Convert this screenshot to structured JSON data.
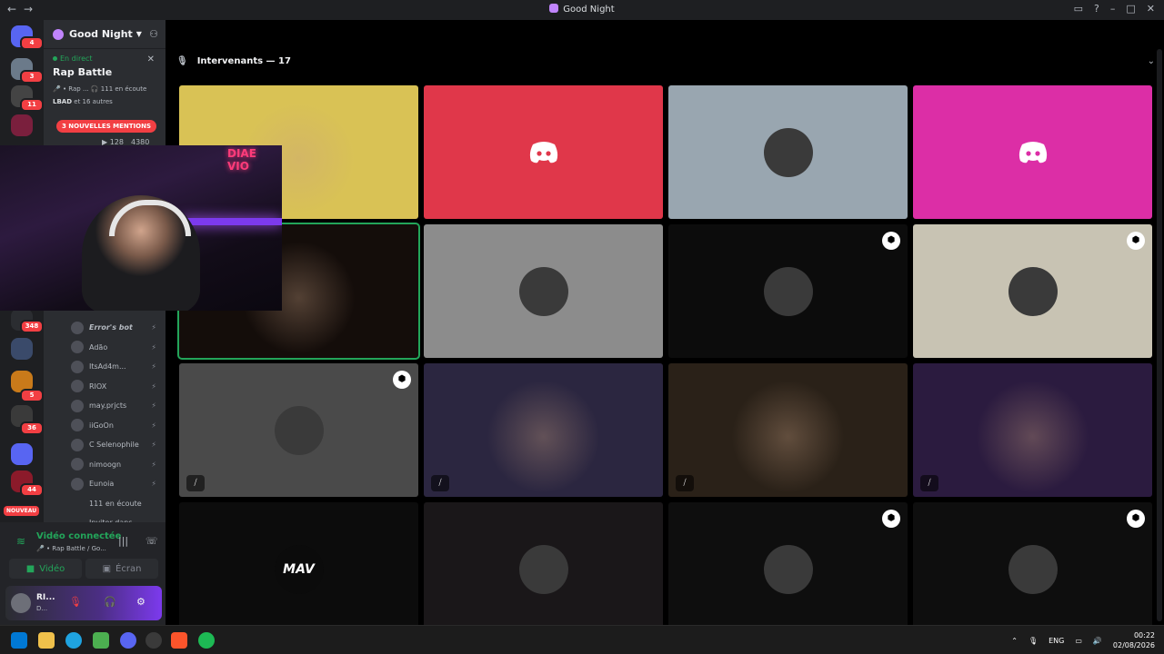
{
  "window": {
    "title": "Good Night"
  },
  "rail_badges": [
    "4",
    "3",
    "11",
    "348",
    "5",
    "36",
    "44"
  ],
  "rail_new_label": "NOUVEAU",
  "server": {
    "name": "Good Night"
  },
  "live": {
    "status": "En direct",
    "title": "Rap Battle",
    "meta": "🎤 • Rap ...  🎧 111 en écoute",
    "people_name": "LBAD",
    "people_rest": " et 16 autres"
  },
  "mentions_label": "3 NOUVELLES MENTIONS",
  "counts": {
    "video": "128",
    "viewers": "4380"
  },
  "members": [
    {
      "name": "Error's bot",
      "bot": true
    },
    {
      "name": "Adão"
    },
    {
      "name": "ItsAd4m..."
    },
    {
      "name": "RIOX"
    },
    {
      "name": "may.prjcts"
    },
    {
      "name": "iiGoOn"
    },
    {
      "name": "C Selenophile"
    },
    {
      "name": "nimoogn"
    },
    {
      "name": "Eunoia"
    }
  ],
  "listeners_label": "111 en écoute",
  "invite_label": "Inviter dans ...",
  "voice": {
    "connected": "Vidéo connectée",
    "sub": "🎤 • Rap Battle / Go...",
    "video_label": "Vidéo",
    "screen_label": "Écran"
  },
  "user": {
    "name": "RI...",
    "status": "D..."
  },
  "speakers_header": "Intervenants — 17",
  "tiles": [
    {
      "kind": "camera",
      "bg": "#d9c255"
    },
    {
      "kind": "discord",
      "bg": "#e0374a"
    },
    {
      "kind": "avatar",
      "bg": "#99a6b0"
    },
    {
      "kind": "discord",
      "bg": "#dc2ea6"
    },
    {
      "kind": "camera",
      "bg": "#140d0a",
      "speaking": true
    },
    {
      "kind": "avatar",
      "bg": "#8c8c8c"
    },
    {
      "kind": "avatar",
      "bg": "#0c0c0c",
      "shield": true
    },
    {
      "kind": "avatar",
      "bg": "#c8c3b3",
      "shield": true
    },
    {
      "kind": "avatar",
      "bg": "#4a4a4a",
      "shield": true,
      "mute": true
    },
    {
      "kind": "camera",
      "bg": "#2b2640",
      "mute": true
    },
    {
      "kind": "camera",
      "bg": "#2a2118",
      "mute": true
    },
    {
      "kind": "camera",
      "bg": "#2b1b3f",
      "mute": true
    },
    {
      "kind": "mav",
      "bg": "#0c0c0c",
      "label": "MAV"
    },
    {
      "kind": "avatar",
      "bg": "#1a1719"
    },
    {
      "kind": "avatar",
      "bg": "#0e0e0e",
      "shield": true
    },
    {
      "kind": "avatar",
      "bg": "#0e0e0e",
      "shield": true
    }
  ],
  "pip_neon": "DIAE VIO",
  "taskbar": {
    "lang": "ENG",
    "time": "00:22",
    "date": "02/08/2026"
  }
}
